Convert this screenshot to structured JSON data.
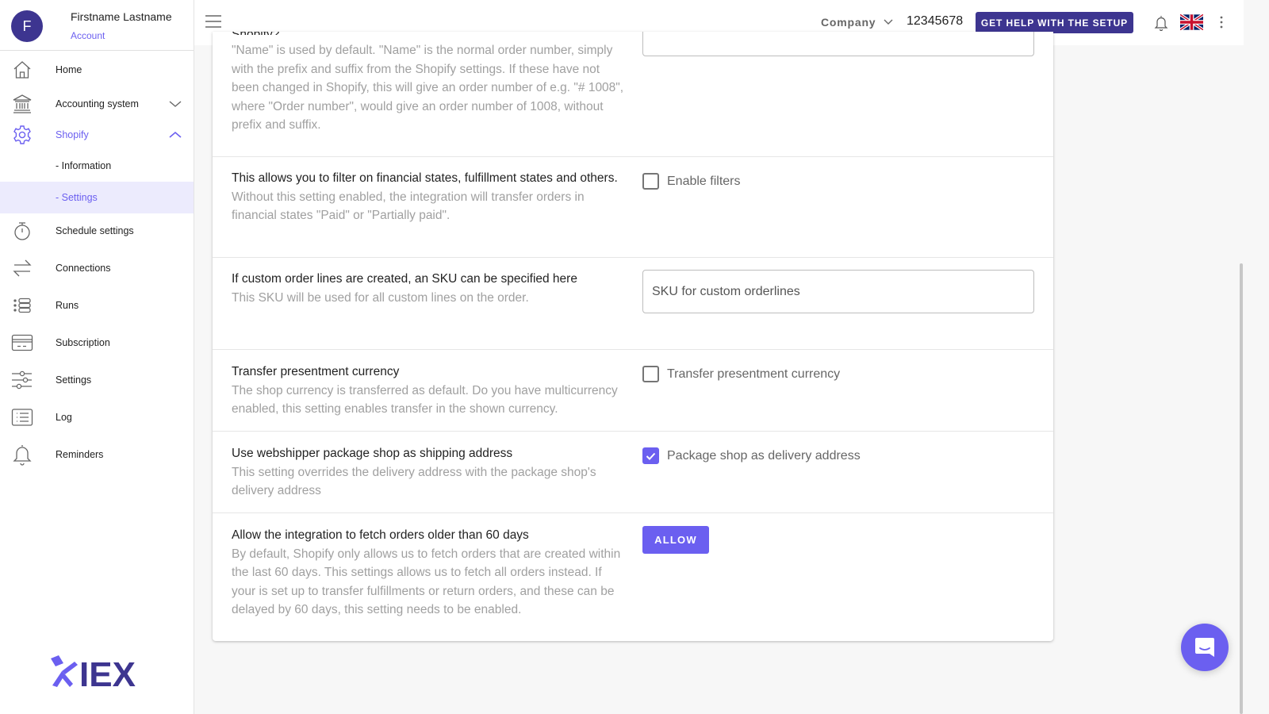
{
  "profile": {
    "initial": "F",
    "name": "Firstname Lastname",
    "subtitle": "Account"
  },
  "sidebar": {
    "items": [
      {
        "label": "Home",
        "icon": "home-icon"
      },
      {
        "label": "Accounting system",
        "icon": "bank-icon",
        "expandable": true,
        "expanded": false
      },
      {
        "label": "Shopify",
        "icon": "gear-icon",
        "expandable": true,
        "expanded": true,
        "active": true
      },
      {
        "label": "- Information",
        "sub": true
      },
      {
        "label": "- Settings",
        "sub": true,
        "selected": true
      },
      {
        "label": "Schedule settings",
        "icon": "stopwatch-icon"
      },
      {
        "label": "Connections",
        "icon": "swap-arrows-icon"
      },
      {
        "label": "Runs",
        "icon": "runs-list-icon"
      },
      {
        "label": "Subscription",
        "icon": "credit-card-icon"
      },
      {
        "label": "Settings",
        "icon": "sliders-icon"
      },
      {
        "label": "Log",
        "icon": "log-list-icon"
      },
      {
        "label": "Reminders",
        "icon": "bell-icon"
      }
    ],
    "logo_text": "IEX"
  },
  "topbar": {
    "company_label": "Company",
    "company_number": "12345678",
    "help_button": "GET HELP WITH THE SETUP",
    "language": "English (UK)"
  },
  "settings": {
    "partial_title": "Shopify?",
    "rows": [
      {
        "title": "",
        "description": "\"Name\" is used by default. \"Name\" is the normal order number, simply with the prefix and suffix from the Shopify settings. If these have not been changed in Shopify, this will give an order number of e.g. \"# 1008\", where \"Order number\", would give an order number of 1008, without prefix and suffix."
      },
      {
        "title": "This allows you to filter on financial states, fulfillment states and others.",
        "description": "Without this setting enabled, the integration will transfer orders in financial states \"Paid\" or \"Partially paid\".",
        "control": {
          "type": "checkbox",
          "label": "Enable filters",
          "checked": false
        }
      },
      {
        "title": "If custom order lines are created, an SKU can be specified here",
        "description": "This SKU will be used for all custom lines on the order.",
        "control": {
          "type": "text",
          "placeholder": "SKU for custom orderlines",
          "value": ""
        }
      },
      {
        "title": "Transfer presentment currency",
        "description": "The shop currency is transferred as default. Do you have multicurrency enabled, this setting enables transfer in the shown currency.",
        "control": {
          "type": "checkbox",
          "label": "Transfer presentment currency",
          "checked": false
        }
      },
      {
        "title": "Use webshipper package shop as shipping address",
        "description": "This setting overrides the delivery address with the package shop's delivery address",
        "control": {
          "type": "checkbox",
          "label": "Package shop as delivery address",
          "checked": true
        }
      },
      {
        "title": "Allow the integration to fetch orders older than 60 days",
        "description": "By default, Shopify only allows us to fetch orders that are created within the last 60 days. This settings allows us to fetch all orders instead. If your is set up to transfer fulfillments or return orders, and these can be delayed by 60 days, this setting needs to be enabled.",
        "control": {
          "type": "button",
          "label": "ALLOW"
        }
      }
    ]
  },
  "colors": {
    "primary": "#3d3590",
    "accent": "#6b5ff0",
    "selected_bg": "#ecebfd"
  }
}
